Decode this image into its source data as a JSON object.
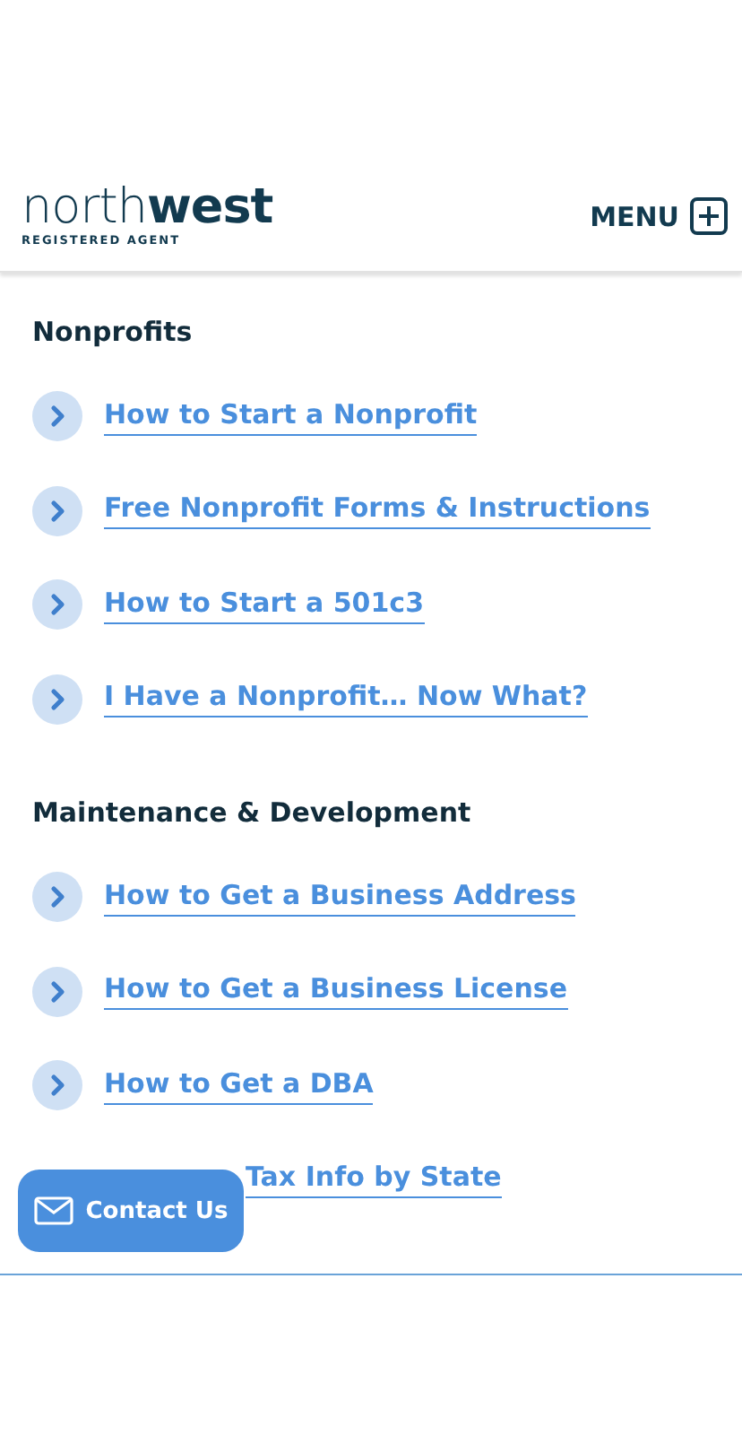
{
  "header": {
    "logo": "north**west**",
    "tagline": "REGISTERED AGENT",
    "menu_label": "MENU"
  },
  "sections": [
    {
      "title": "Nonprofits",
      "links": [
        {
          "label": "How to Start a Nonprofit",
          "kind": "full"
        },
        {
          "label": "Free Nonprofit Forms & Instructions",
          "kind": "full"
        },
        {
          "label": "How to Start a 501c3",
          "kind": "full"
        },
        {
          "label": "I Have a Nonprofit… Now What?",
          "kind": "full"
        }
      ]
    },
    {
      "title": "Maintenance & Development",
      "links": [
        {
          "label": "How to Get a Business Address",
          "kind": "full"
        },
        {
          "label": "How to Get a Business License",
          "kind": "full"
        },
        {
          "label": "How to Get a DBA",
          "kind": "full"
        },
        {
          "label": "Tax Info by State",
          "kind": "covered"
        }
      ]
    }
  ],
  "contact_button": {
    "label": "Contact Us"
  }
}
